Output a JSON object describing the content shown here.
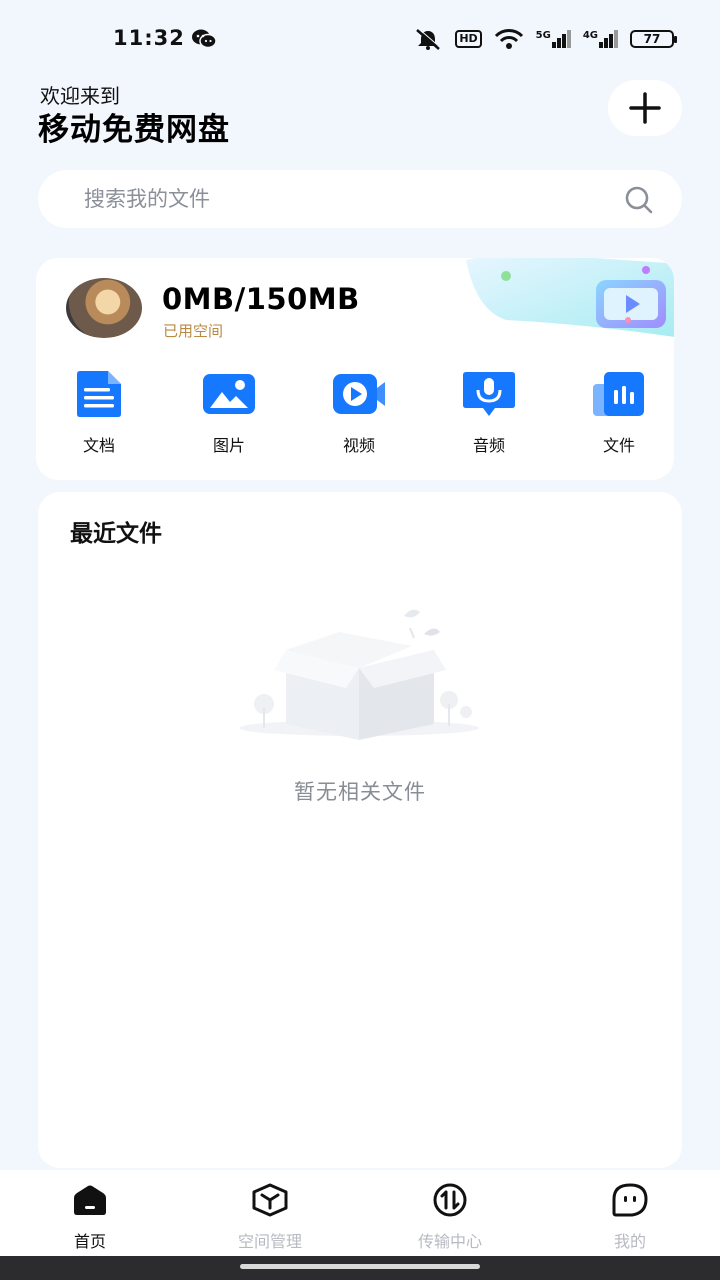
{
  "status_bar": {
    "time": "11:32",
    "hd": "HD",
    "signal_5g": "5G",
    "signal_4g": "4G",
    "battery": "77"
  },
  "header": {
    "welcome": "欢迎来到",
    "title": "移动免费网盘"
  },
  "search": {
    "placeholder": "搜索我的文件"
  },
  "storage": {
    "usage": "0MB/150MB",
    "usage_label": "已用空间",
    "categories": [
      {
        "label": "文档",
        "icon": "document-icon"
      },
      {
        "label": "图片",
        "icon": "image-icon"
      },
      {
        "label": "视频",
        "icon": "video-icon"
      },
      {
        "label": "音频",
        "icon": "audio-icon"
      },
      {
        "label": "文件",
        "icon": "file-icon"
      }
    ]
  },
  "recent": {
    "title": "最近文件",
    "empty_text": "暂无相关文件"
  },
  "bottom_nav": {
    "items": [
      {
        "label": "首页",
        "icon": "home-icon",
        "active": true
      },
      {
        "label": "空间管理",
        "icon": "box-icon",
        "active": false
      },
      {
        "label": "传输中心",
        "icon": "transfer-icon",
        "active": false
      },
      {
        "label": "我的",
        "icon": "profile-icon",
        "active": false
      }
    ]
  },
  "colors": {
    "accent": "#1677ff",
    "background": "#f2f6fd",
    "muted_text": "#b7bac1",
    "usage_label": "#b88a45"
  }
}
